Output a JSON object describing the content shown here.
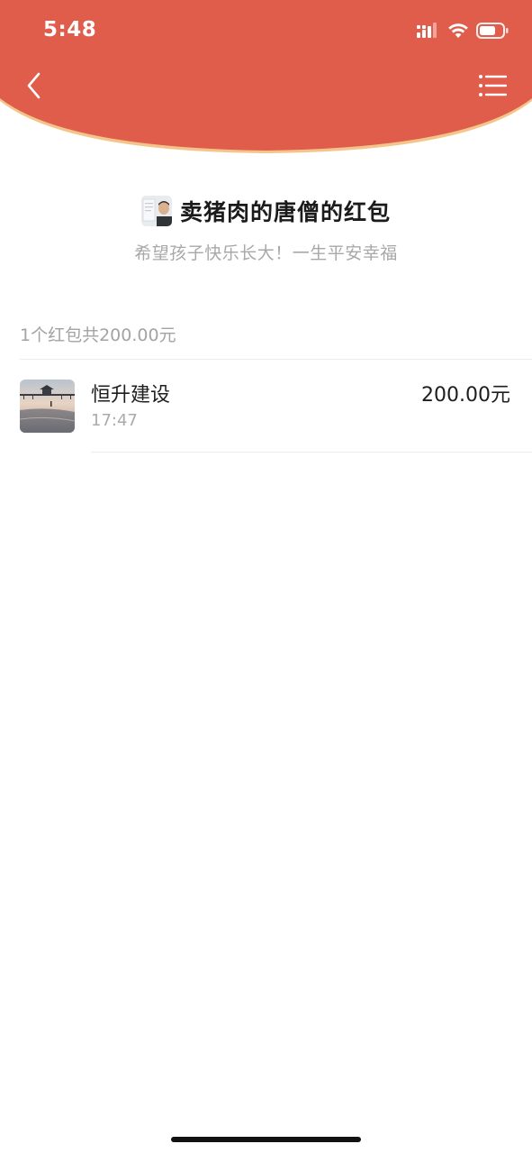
{
  "colors": {
    "header_red": "#E05C4B",
    "header_edge": "#F3C58A",
    "title_text": "#1B1B1B",
    "secondary_text": "#A8A8A8"
  },
  "status_bar": {
    "time": "5:48",
    "icons": [
      "cellular-signal-icon",
      "wifi-icon",
      "battery-icon"
    ]
  },
  "nav": {
    "back_icon": "chevron-left-icon",
    "menu_icon": "list-menu-icon"
  },
  "envelope": {
    "sender_title": "卖猪肉的唐僧的红包",
    "blessing": "希望孩子快乐长大！一生平安幸福",
    "summary": "1个红包共200.00元"
  },
  "records": [
    {
      "name": "恒升建设",
      "time": "17:47",
      "amount": "200.00元"
    }
  ]
}
